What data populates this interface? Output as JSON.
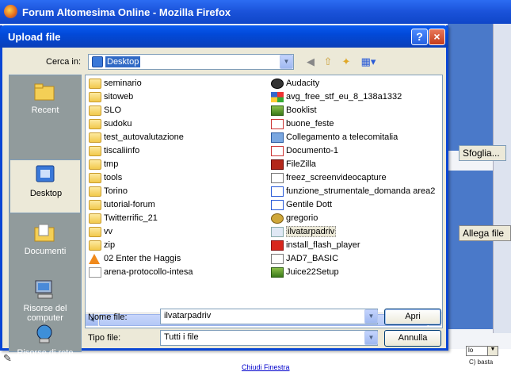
{
  "browser": {
    "title": "Forum Altomesima Online - Mozilla Firefox",
    "browse_button": "Sfoglia...",
    "attach_button": "Allega file",
    "close_link": "Chiudi Finestra",
    "status_fragment": "C) basta",
    "small_field_value": "lo"
  },
  "dialog": {
    "title": "Upload file",
    "help_label": "?",
    "close_label": "×",
    "look_in_label": "Cerca in:",
    "look_in_value": "Desktop",
    "places": [
      {
        "label": "Recent",
        "icon": "recent-folder-icon"
      },
      {
        "label": "Desktop",
        "icon": "desktop-icon"
      },
      {
        "label": "Documenti",
        "icon": "documents-folder-icon"
      },
      {
        "label": "Risorse del computer",
        "icon": "my-computer-icon"
      },
      {
        "label": "Risorse di rete",
        "icon": "network-icon"
      }
    ],
    "files_col1": [
      {
        "name": "seminario",
        "icon": "folder"
      },
      {
        "name": "sitoweb",
        "icon": "folder"
      },
      {
        "name": "SLO",
        "icon": "folder"
      },
      {
        "name": "sudoku",
        "icon": "folder"
      },
      {
        "name": "test_autovalutazione",
        "icon": "folder"
      },
      {
        "name": "tiscaliinfo",
        "icon": "folder"
      },
      {
        "name": "tmp",
        "icon": "folder"
      },
      {
        "name": "tools",
        "icon": "folder"
      },
      {
        "name": "Torino",
        "icon": "folder"
      },
      {
        "name": "tutorial-forum",
        "icon": "folder"
      },
      {
        "name": "Twitterrific_21",
        "icon": "folder"
      },
      {
        "name": "vv",
        "icon": "folder"
      },
      {
        "name": "zip",
        "icon": "folder"
      },
      {
        "name": "02 Enter the Haggis",
        "icon": "vlc"
      },
      {
        "name": "arena-protocollo-intesa",
        "icon": "doc"
      }
    ],
    "files_col2": [
      {
        "name": "Audacity",
        "icon": "audio"
      },
      {
        "name": "avg_free_stf_eu_8_138a1332",
        "icon": "avg"
      },
      {
        "name": "Booklist",
        "icon": "app"
      },
      {
        "name": "buone_feste",
        "icon": "pdf"
      },
      {
        "name": "Collegamento a telecomitalia",
        "icon": "conn"
      },
      {
        "name": "Documento-1",
        "icon": "pdf"
      },
      {
        "name": "FileZilla",
        "icon": "fz"
      },
      {
        "name": "freez_screenvideocapture",
        "icon": "exe"
      },
      {
        "name": "funzione_strumentale_domanda area2",
        "icon": "word"
      },
      {
        "name": "Gentile Dott",
        "icon": "word"
      },
      {
        "name": "gregorio",
        "icon": "gear"
      },
      {
        "name": "ilvatarpadriv",
        "icon": "img"
      },
      {
        "name": "install_flash_player",
        "icon": "red"
      },
      {
        "name": "JAD7_BASIC",
        "icon": "exe"
      },
      {
        "name": "Juice22Setup",
        "icon": "app"
      }
    ],
    "selected_file": "ilvatarpadriv",
    "filename_label": "Nome file:",
    "filename_value": "ilvatarpadriv",
    "filetype_label": "Tipo file:",
    "filetype_value": "Tutti i file",
    "open_button": "Apri",
    "cancel_button": "Annulla"
  }
}
